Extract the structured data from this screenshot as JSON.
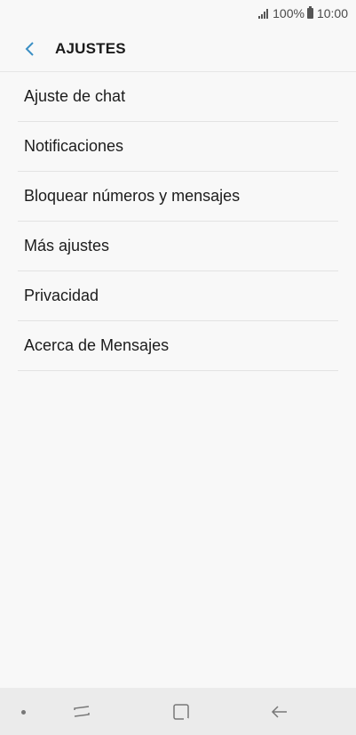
{
  "status_bar": {
    "battery": "100%",
    "time": "10:00",
    "signal_icon": "signal-icon",
    "battery_icon": "battery-icon"
  },
  "app_bar": {
    "back_icon": "chevron-left-icon",
    "title": "AJUSTES",
    "accent_color": "#3b8fc4"
  },
  "settings": {
    "items": [
      {
        "label": "Ajuste de chat"
      },
      {
        "label": "Notificaciones"
      },
      {
        "label": "Bloquear números y mensajes"
      },
      {
        "label": "Más ajustes"
      },
      {
        "label": "Privacidad"
      },
      {
        "label": "Acerca de Mensajes"
      }
    ]
  },
  "nav_bar": {
    "recents_icon": "recents-icon",
    "home_icon": "home-icon",
    "back_icon": "back-arrow-icon"
  }
}
